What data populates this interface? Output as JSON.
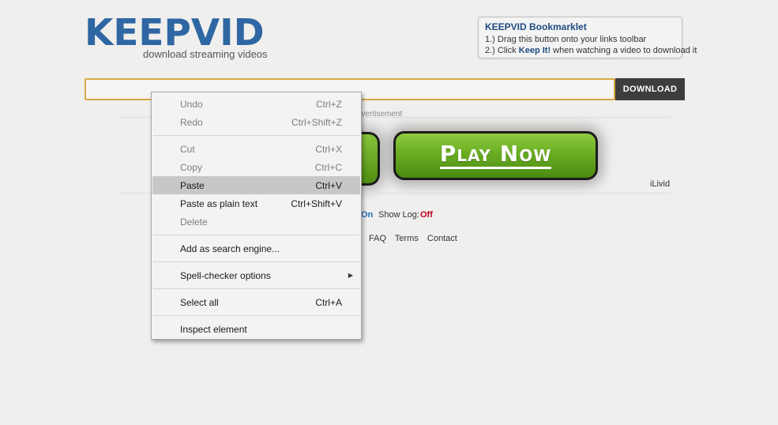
{
  "header": {
    "logo_text": "KEEPVID",
    "tagline": "download streaming videos"
  },
  "bookmarklet": {
    "title": "KEEPVID Bookmarklet",
    "step1": "1.) Drag this button onto your links toolbar",
    "step2_prefix": "2.) Click ",
    "step2_link": "Keep It!",
    "step2_suffix": " when watching a video to download it"
  },
  "search": {
    "value": "",
    "download_label": "DOWNLOAD"
  },
  "ad": {
    "label": "dvertisement",
    "play_now": "Play Now",
    "ilivid": "iLivid"
  },
  "options": {
    "on_label": "On",
    "show_log_label": "Show Log:",
    "show_log_value": "Off"
  },
  "footer_links": [
    "FAQ",
    "Terms",
    "Contact"
  ],
  "context_menu": {
    "items": [
      {
        "label": "Undo",
        "shortcut": "Ctrl+Z"
      },
      {
        "label": "Redo",
        "shortcut": "Ctrl+Shift+Z"
      },
      {
        "label": "Cut",
        "shortcut": "Ctrl+X"
      },
      {
        "label": "Copy",
        "shortcut": "Ctrl+C"
      },
      {
        "label": "Paste",
        "shortcut": "Ctrl+V"
      },
      {
        "label": "Paste as plain text",
        "shortcut": "Ctrl+Shift+V"
      },
      {
        "label": "Delete",
        "shortcut": ""
      },
      {
        "label": "Add as search engine...",
        "shortcut": ""
      },
      {
        "label": "Spell-checker options",
        "shortcut": ""
      },
      {
        "label": "Select all",
        "shortcut": "Ctrl+A"
      },
      {
        "label": "Inspect element",
        "shortcut": ""
      }
    ]
  },
  "colors": {
    "logo_blue": "#2e67a3",
    "input_border": "#d8a845",
    "play_green": "#6aad22",
    "log_off_red": "#c0001f",
    "on_blue": "#1d6fb5"
  }
}
